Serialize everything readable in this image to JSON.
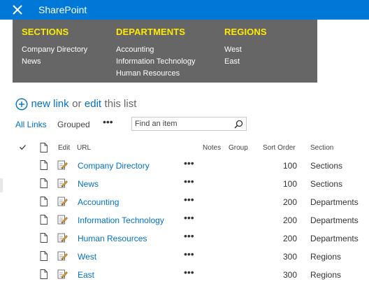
{
  "app": {
    "title": "SharePoint",
    "close_icon": "close-icon"
  },
  "megamenu": {
    "columns": [
      {
        "heading": "SECTIONS",
        "links": [
          "Company Directory",
          "News"
        ]
      },
      {
        "heading": "DEPARTMENTS",
        "links": [
          "Accounting",
          "Information Technology",
          "Human Resources"
        ]
      },
      {
        "heading": "REGIONS",
        "links": [
          "West",
          "East"
        ]
      }
    ]
  },
  "actions": {
    "new_link": "new link",
    "or": "or",
    "edit": "edit",
    "this_list": "this list"
  },
  "views": {
    "all_links": "All Links",
    "grouped": "Grouped",
    "more": "•••"
  },
  "search": {
    "placeholder": "Find an item"
  },
  "table": {
    "headers": {
      "edit": "Edit",
      "url": "URL",
      "notes": "Notes",
      "group": "Group",
      "sort_order": "Sort Order",
      "section": "Section"
    },
    "rows": [
      {
        "url": "Company Directory",
        "more": "•••",
        "sort_order": "100",
        "section": "Sections"
      },
      {
        "url": "News",
        "more": "•••",
        "sort_order": "100",
        "section": "Sections"
      },
      {
        "url": "Accounting",
        "more": "•••",
        "sort_order": "200",
        "section": "Departments"
      },
      {
        "url": "Information Technology",
        "more": "•••",
        "sort_order": "200",
        "section": "Departments"
      },
      {
        "url": "Human Resources",
        "more": "•••",
        "sort_order": "200",
        "section": "Departments"
      },
      {
        "url": "West",
        "more": "•••",
        "sort_order": "300",
        "section": "Regions"
      },
      {
        "url": "East",
        "more": "•••",
        "sort_order": "300",
        "section": "Regions"
      }
    ]
  },
  "colors": {
    "suite_bar": "#0078d7",
    "menu_bg": "#666666",
    "menu_heading": "#ffeb00",
    "link": "#0072c6"
  }
}
